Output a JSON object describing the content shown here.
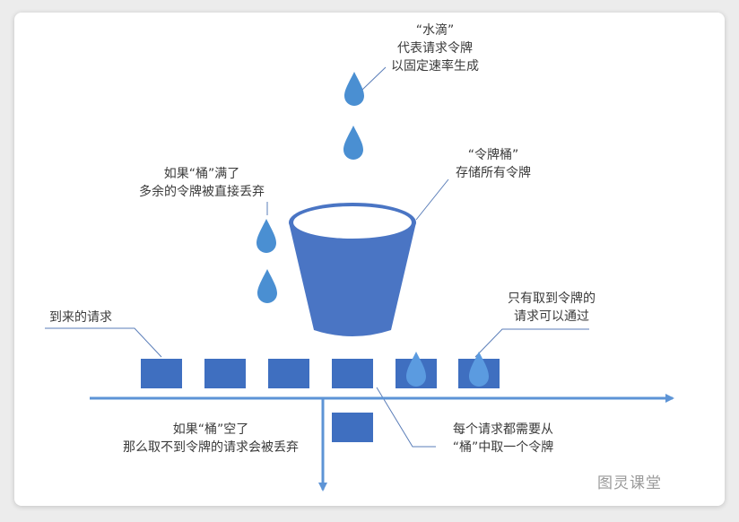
{
  "labels": {
    "water_drop": {
      "line1": "“水滴”",
      "line2": "代表请求令牌",
      "line3": "以固定速率生成"
    },
    "token_bucket": {
      "line1": "“令牌桶”",
      "line2": "存储所有令牌"
    },
    "bucket_full": {
      "line1": "如果“桶”满了",
      "line2": "多余的令牌被直接丢弃"
    },
    "incoming": {
      "line1": "到来的请求"
    },
    "passing": {
      "line1": "只有取到令牌的",
      "line2": "请求可以通过"
    },
    "bucket_empty": {
      "line1": "如果“桶”空了",
      "line2": "那么取不到令牌的请求会被丢弃"
    },
    "each_request": {
      "line1": "每个请求都需要从",
      "line2": "“桶”中取一个令牌"
    }
  },
  "watermark": "图灵课堂",
  "colors": {
    "drop": "#4a8fd2",
    "bucket": "#4a75c4",
    "request_box": "#3f6fc0",
    "arrow": "#5d94d6",
    "line": "#5a7db8"
  }
}
